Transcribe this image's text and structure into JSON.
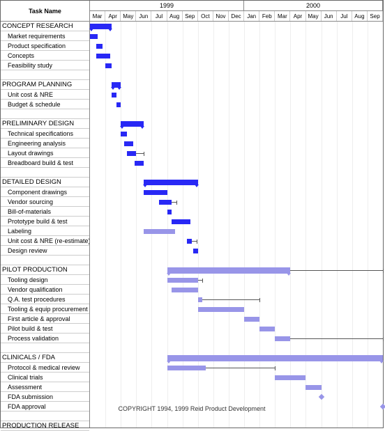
{
  "header": {
    "task_col_label": "Task Name"
  },
  "timeline": {
    "years": [
      {
        "label": "1999",
        "months": 10
      },
      {
        "label": "2000",
        "months": 9
      }
    ],
    "months": [
      "Mar",
      "Apr",
      "May",
      "Jun",
      "Jul",
      "Aug",
      "Sep",
      "Oct",
      "Nov",
      "Dec",
      "Jan",
      "Feb",
      "Mar",
      "Apr",
      "May",
      "Jun",
      "Jul",
      "Aug",
      "Sep"
    ]
  },
  "footer": "COPYRIGHT 1994, 1999  Reid Product Development",
  "chart_data": {
    "type": "gantt",
    "x_unit": "month",
    "x_start": "1999-03",
    "x_end": "2000-09",
    "rows": [
      {
        "name": "CONCEPT RESEARCH",
        "kind": "phase",
        "bar": {
          "style": "summary",
          "start": 0.0,
          "end": 1.4
        }
      },
      {
        "name": "Market requirements",
        "kind": "sub",
        "bar": {
          "style": "solid",
          "start": 0.0,
          "end": 0.5
        }
      },
      {
        "name": "Product specification",
        "kind": "sub",
        "bar": {
          "style": "solid",
          "start": 0.4,
          "end": 0.8
        }
      },
      {
        "name": "Concepts",
        "kind": "sub",
        "bar": {
          "style": "solid",
          "start": 0.4,
          "end": 1.3
        }
      },
      {
        "name": "Feasibility study",
        "kind": "sub",
        "bar": {
          "style": "solid",
          "start": 1.0,
          "end": 1.4
        }
      },
      {
        "name": "",
        "kind": "spacer"
      },
      {
        "name": "PROGRAM PLANNING",
        "kind": "phase",
        "bar": {
          "style": "summary",
          "start": 1.4,
          "end": 2.0
        }
      },
      {
        "name": "Unit cost & NRE",
        "kind": "sub",
        "bar": {
          "style": "solid",
          "start": 1.4,
          "end": 1.7
        }
      },
      {
        "name": "Budget & schedule",
        "kind": "sub",
        "bar": {
          "style": "solid",
          "start": 1.7,
          "end": 2.0
        }
      },
      {
        "name": "",
        "kind": "spacer"
      },
      {
        "name": "PRELIMINARY DESIGN",
        "kind": "phase",
        "bar": {
          "style": "summary",
          "start": 2.0,
          "end": 3.5
        }
      },
      {
        "name": "Technical specifications",
        "kind": "sub",
        "bar": {
          "style": "solid",
          "start": 2.0,
          "end": 2.4
        }
      },
      {
        "name": "Engineering analysis",
        "kind": "sub",
        "bar": {
          "style": "solid",
          "start": 2.2,
          "end": 2.8
        }
      },
      {
        "name": "Layout drawings",
        "kind": "sub",
        "bar": {
          "style": "solid",
          "start": 2.4,
          "end": 3.0
        },
        "slack_to": 3.5
      },
      {
        "name": "Breadboard build & test",
        "kind": "sub",
        "bar": {
          "style": "solid",
          "start": 2.9,
          "end": 3.5
        }
      },
      {
        "name": "",
        "kind": "spacer"
      },
      {
        "name": "DETAILED DESIGN",
        "kind": "phase",
        "bar": {
          "style": "summary",
          "start": 3.5,
          "end": 7.0
        }
      },
      {
        "name": "Component drawings",
        "kind": "sub",
        "bar": {
          "style": "solid",
          "start": 3.5,
          "end": 5.0
        }
      },
      {
        "name": "Vendor sourcing",
        "kind": "sub",
        "bar": {
          "style": "solid",
          "start": 4.5,
          "end": 5.3
        },
        "slack_to": 5.6
      },
      {
        "name": "Bill-of-materials",
        "kind": "sub",
        "bar": {
          "style": "solid",
          "start": 5.0,
          "end": 5.3
        }
      },
      {
        "name": "Prototype build & test",
        "kind": "sub",
        "bar": {
          "style": "solid",
          "start": 5.3,
          "end": 6.5
        }
      },
      {
        "name": "Labeling",
        "kind": "sub",
        "bar": {
          "style": "light",
          "start": 3.5,
          "end": 5.5
        }
      },
      {
        "name": "Unit cost & NRE (re-estimate)",
        "kind": "sub",
        "bar": {
          "style": "solid",
          "start": 6.3,
          "end": 6.6
        },
        "slack_to": 6.9
      },
      {
        "name": "Design review",
        "kind": "sub",
        "bar": {
          "style": "solid",
          "start": 6.7,
          "end": 7.0
        }
      },
      {
        "name": "",
        "kind": "spacer"
      },
      {
        "name": "PILOT PRODUCTION",
        "kind": "phase",
        "bar": {
          "style": "light-summary",
          "start": 5.0,
          "end": 13.0
        },
        "slack_to": 19.0
      },
      {
        "name": "Tooling design",
        "kind": "sub",
        "bar": {
          "style": "light",
          "start": 5.0,
          "end": 7.0
        },
        "slack_to": 7.3
      },
      {
        "name": "Vendor qualification",
        "kind": "sub",
        "bar": {
          "style": "light",
          "start": 5.3,
          "end": 7.0
        }
      },
      {
        "name": "Q.A. test procedures",
        "kind": "sub",
        "bar": {
          "style": "light",
          "start": 7.0,
          "end": 7.3
        },
        "slack_to": 11.0
      },
      {
        "name": "Tooling & equip procurement",
        "kind": "sub",
        "bar": {
          "style": "light",
          "start": 7.0,
          "end": 10.0
        }
      },
      {
        "name": "First article & approval",
        "kind": "sub",
        "bar": {
          "style": "light",
          "start": 10.0,
          "end": 11.0
        }
      },
      {
        "name": "Pilot build & test",
        "kind": "sub",
        "bar": {
          "style": "light",
          "start": 11.0,
          "end": 12.0
        }
      },
      {
        "name": "Process validation",
        "kind": "sub",
        "bar": {
          "style": "light",
          "start": 12.0,
          "end": 13.0
        },
        "slack_to": 19.0
      },
      {
        "name": "",
        "kind": "spacer"
      },
      {
        "name": "CLINICALS / FDA",
        "kind": "phase",
        "bar": {
          "style": "light-summary",
          "start": 5.0,
          "end": 19.0
        }
      },
      {
        "name": "Protocol & medical review",
        "kind": "sub",
        "bar": {
          "style": "light",
          "start": 5.0,
          "end": 7.5
        },
        "slack_to": 12.0
      },
      {
        "name": "Clinical trials",
        "kind": "sub",
        "bar": {
          "style": "light",
          "start": 12.0,
          "end": 14.0
        }
      },
      {
        "name": "Assessment",
        "kind": "sub",
        "bar": {
          "style": "light",
          "start": 14.0,
          "end": 15.0
        }
      },
      {
        "name": "FDA submission",
        "kind": "sub",
        "milestone_at": 15.0
      },
      {
        "name": "FDA approval",
        "kind": "sub",
        "milestone_at": 19.0
      },
      {
        "name": "",
        "kind": "spacer"
      },
      {
        "name": "PRODUCTION RELEASE",
        "kind": "phase"
      }
    ]
  }
}
